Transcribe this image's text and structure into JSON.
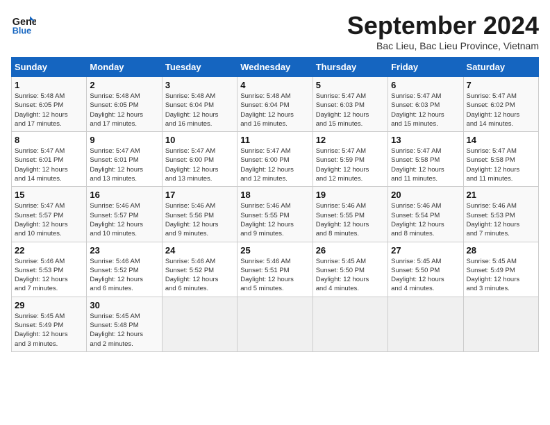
{
  "header": {
    "logo_line1": "General",
    "logo_line2": "Blue",
    "title": "September 2024",
    "subtitle": "Bac Lieu, Bac Lieu Province, Vietnam"
  },
  "days_of_week": [
    "Sunday",
    "Monday",
    "Tuesday",
    "Wednesday",
    "Thursday",
    "Friday",
    "Saturday"
  ],
  "weeks": [
    [
      {
        "day": "1",
        "info": "Sunrise: 5:48 AM\nSunset: 6:05 PM\nDaylight: 12 hours\nand 17 minutes."
      },
      {
        "day": "2",
        "info": "Sunrise: 5:48 AM\nSunset: 6:05 PM\nDaylight: 12 hours\nand 17 minutes."
      },
      {
        "day": "3",
        "info": "Sunrise: 5:48 AM\nSunset: 6:04 PM\nDaylight: 12 hours\nand 16 minutes."
      },
      {
        "day": "4",
        "info": "Sunrise: 5:48 AM\nSunset: 6:04 PM\nDaylight: 12 hours\nand 16 minutes."
      },
      {
        "day": "5",
        "info": "Sunrise: 5:47 AM\nSunset: 6:03 PM\nDaylight: 12 hours\nand 15 minutes."
      },
      {
        "day": "6",
        "info": "Sunrise: 5:47 AM\nSunset: 6:03 PM\nDaylight: 12 hours\nand 15 minutes."
      },
      {
        "day": "7",
        "info": "Sunrise: 5:47 AM\nSunset: 6:02 PM\nDaylight: 12 hours\nand 14 minutes."
      }
    ],
    [
      {
        "day": "8",
        "info": "Sunrise: 5:47 AM\nSunset: 6:01 PM\nDaylight: 12 hours\nand 14 minutes."
      },
      {
        "day": "9",
        "info": "Sunrise: 5:47 AM\nSunset: 6:01 PM\nDaylight: 12 hours\nand 13 minutes."
      },
      {
        "day": "10",
        "info": "Sunrise: 5:47 AM\nSunset: 6:00 PM\nDaylight: 12 hours\nand 13 minutes."
      },
      {
        "day": "11",
        "info": "Sunrise: 5:47 AM\nSunset: 6:00 PM\nDaylight: 12 hours\nand 12 minutes."
      },
      {
        "day": "12",
        "info": "Sunrise: 5:47 AM\nSunset: 5:59 PM\nDaylight: 12 hours\nand 12 minutes."
      },
      {
        "day": "13",
        "info": "Sunrise: 5:47 AM\nSunset: 5:58 PM\nDaylight: 12 hours\nand 11 minutes."
      },
      {
        "day": "14",
        "info": "Sunrise: 5:47 AM\nSunset: 5:58 PM\nDaylight: 12 hours\nand 11 minutes."
      }
    ],
    [
      {
        "day": "15",
        "info": "Sunrise: 5:47 AM\nSunset: 5:57 PM\nDaylight: 12 hours\nand 10 minutes."
      },
      {
        "day": "16",
        "info": "Sunrise: 5:46 AM\nSunset: 5:57 PM\nDaylight: 12 hours\nand 10 minutes."
      },
      {
        "day": "17",
        "info": "Sunrise: 5:46 AM\nSunset: 5:56 PM\nDaylight: 12 hours\nand 9 minutes."
      },
      {
        "day": "18",
        "info": "Sunrise: 5:46 AM\nSunset: 5:55 PM\nDaylight: 12 hours\nand 9 minutes."
      },
      {
        "day": "19",
        "info": "Sunrise: 5:46 AM\nSunset: 5:55 PM\nDaylight: 12 hours\nand 8 minutes."
      },
      {
        "day": "20",
        "info": "Sunrise: 5:46 AM\nSunset: 5:54 PM\nDaylight: 12 hours\nand 8 minutes."
      },
      {
        "day": "21",
        "info": "Sunrise: 5:46 AM\nSunset: 5:53 PM\nDaylight: 12 hours\nand 7 minutes."
      }
    ],
    [
      {
        "day": "22",
        "info": "Sunrise: 5:46 AM\nSunset: 5:53 PM\nDaylight: 12 hours\nand 7 minutes."
      },
      {
        "day": "23",
        "info": "Sunrise: 5:46 AM\nSunset: 5:52 PM\nDaylight: 12 hours\nand 6 minutes."
      },
      {
        "day": "24",
        "info": "Sunrise: 5:46 AM\nSunset: 5:52 PM\nDaylight: 12 hours\nand 6 minutes."
      },
      {
        "day": "25",
        "info": "Sunrise: 5:46 AM\nSunset: 5:51 PM\nDaylight: 12 hours\nand 5 minutes."
      },
      {
        "day": "26",
        "info": "Sunrise: 5:45 AM\nSunset: 5:50 PM\nDaylight: 12 hours\nand 4 minutes."
      },
      {
        "day": "27",
        "info": "Sunrise: 5:45 AM\nSunset: 5:50 PM\nDaylight: 12 hours\nand 4 minutes."
      },
      {
        "day": "28",
        "info": "Sunrise: 5:45 AM\nSunset: 5:49 PM\nDaylight: 12 hours\nand 3 minutes."
      }
    ],
    [
      {
        "day": "29",
        "info": "Sunrise: 5:45 AM\nSunset: 5:49 PM\nDaylight: 12 hours\nand 3 minutes."
      },
      {
        "day": "30",
        "info": "Sunrise: 5:45 AM\nSunset: 5:48 PM\nDaylight: 12 hours\nand 2 minutes."
      },
      {
        "day": "",
        "info": ""
      },
      {
        "day": "",
        "info": ""
      },
      {
        "day": "",
        "info": ""
      },
      {
        "day": "",
        "info": ""
      },
      {
        "day": "",
        "info": ""
      }
    ]
  ]
}
